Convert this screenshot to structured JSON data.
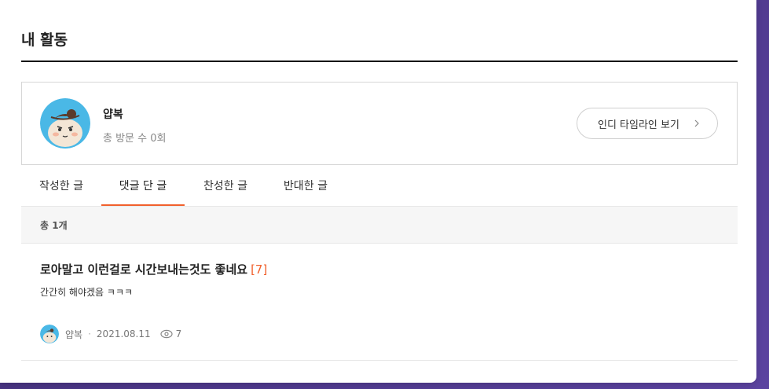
{
  "page": {
    "title": "내 활동"
  },
  "profile": {
    "nickname": "얍복",
    "visits": "총 방문 수 0회",
    "timeline_button": "인디 타임라인 보기"
  },
  "tabs": [
    {
      "label": "작성한 글",
      "active": false
    },
    {
      "label": "댓글 단 글",
      "active": true
    },
    {
      "label": "찬성한 글",
      "active": false
    },
    {
      "label": "반대한 글",
      "active": false
    }
  ],
  "summary": {
    "total": "총 1개"
  },
  "posts": [
    {
      "title": "로아말고 이런걸로 시간보내는것도 좋네요",
      "comment_count": "[7]",
      "excerpt": "간간히 해야겠음 ㅋㅋㅋ",
      "author": "얍복",
      "separator": "·",
      "date": "2021.08.11",
      "views": "7"
    }
  ],
  "colors": {
    "accent": "#f1602c",
    "avatar_bg": "#4ab8e6"
  },
  "icons": {
    "chevron": "chevron-right-icon",
    "views": "eye-icon"
  }
}
